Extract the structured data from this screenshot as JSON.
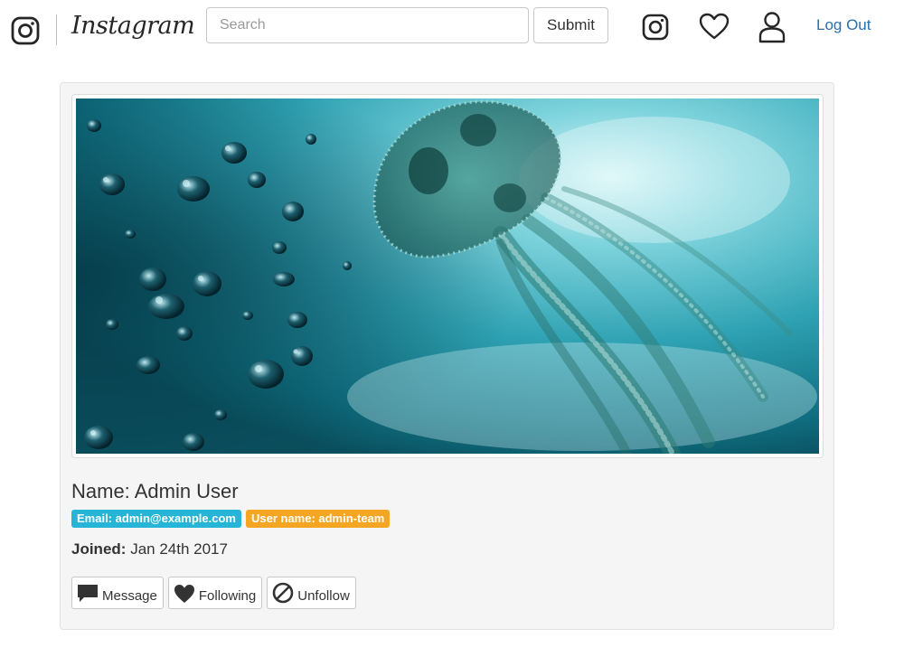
{
  "navbar": {
    "brand_name": "Instagram",
    "search": {
      "placeholder": "Search",
      "value": ""
    },
    "submit_label": "Submit",
    "logout_label": "Log Out",
    "icons": [
      "instagram-camera-icon",
      "heart-icon",
      "user-icon"
    ]
  },
  "profile": {
    "name_label": "Name:",
    "name": "Admin User",
    "email_badge": "Email: admin@example.com",
    "username_badge": "User name: admin-team",
    "joined_label": "Joined:",
    "joined_date": "Jan 24th 2017",
    "photo_subject": "jellyfish underwater with bubbles"
  },
  "actions": {
    "message_label": "Message",
    "following_label": "Following",
    "unfollow_label": "Unfollow"
  },
  "colors": {
    "link": "#2a6fad",
    "badge_email": "#26b5d6",
    "badge_username": "#f4a623",
    "card_bg": "#f5f5f5"
  }
}
